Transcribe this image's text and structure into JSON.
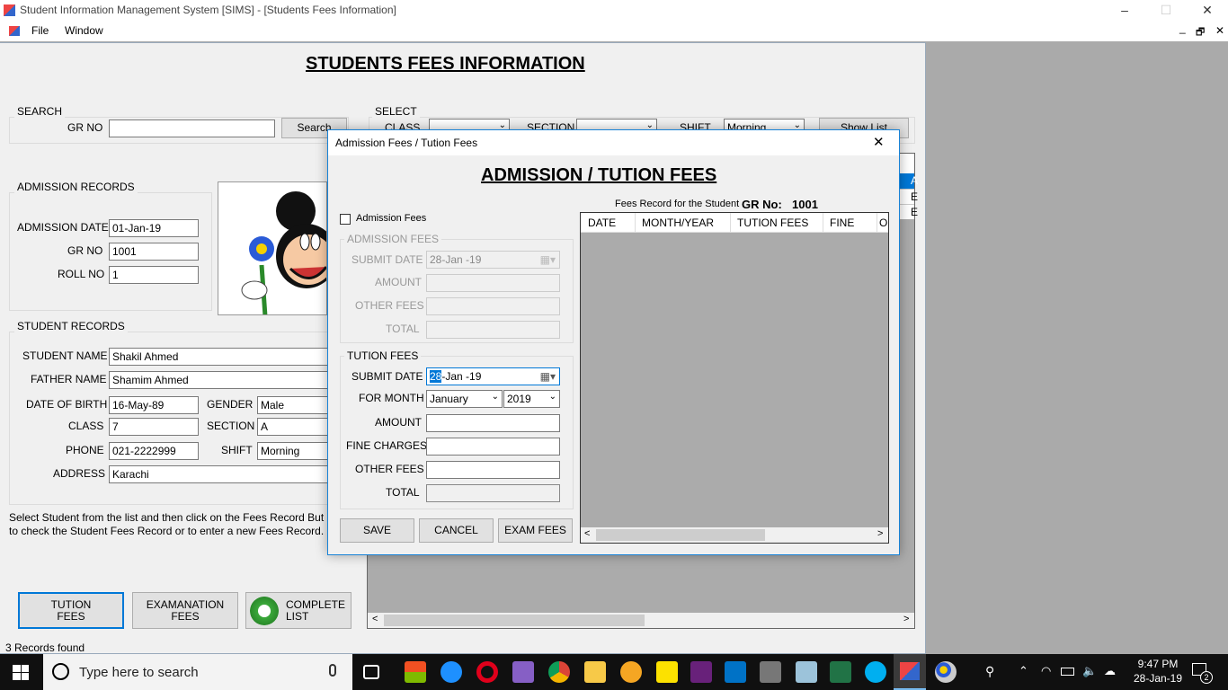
{
  "window": {
    "title": "Student Information Management System [SIMS] - [Students Fees Information]",
    "minimize": "–",
    "maximize": "☐",
    "close": "✕"
  },
  "menu": {
    "file": "File",
    "window": "Window",
    "child_min": "_",
    "child_restore": "🗗",
    "child_close": "✕"
  },
  "form": {
    "heading": "STUDENTS FEES INFORMATION",
    "search": {
      "group": "SEARCH",
      "gr_label": "GR NO",
      "gr_value": "",
      "button": "Search"
    },
    "select": {
      "group": "SELECT",
      "class_label": "CLASS",
      "section_label": "SECTION",
      "shift_label": "SHIFT",
      "shift_value": "Morning",
      "show_list": "Show List"
    },
    "admission": {
      "group": "ADMISSION RECORDS",
      "date_label": "ADMISSION DATE",
      "date_value": "01-Jan-19",
      "gr_label": "GR NO",
      "gr_value": "1001",
      "roll_label": "ROLL NO",
      "roll_value": "1"
    },
    "student": {
      "group": "STUDENT RECORDS",
      "name_label": "STUDENT NAME",
      "name_value": "Shakil Ahmed",
      "father_label": "FATHER NAME",
      "father_value": "Shamim Ahmed",
      "dob_label": "DATE OF BIRTH",
      "dob_value": "16-May-89",
      "gender_label": "GENDER",
      "gender_value": "Male",
      "class_label": "CLASS",
      "class_value": "7",
      "section_label": "SECTION",
      "section_value": "A",
      "phone_label": "PHONE",
      "phone_value": "021-2222999",
      "shift_label": "SHIFT",
      "shift_value": "Morning",
      "address_label": "ADDRESS",
      "address_value": "Karachi"
    },
    "instruction_1": "Select Student from the list and then click on the Fees Record But",
    "instruction_2": "to check the Student Fees Record or to enter a new Fees Record.",
    "buttons": {
      "tution_1": "TUTION",
      "tution_2": "FEES",
      "exam_1": "EXAMANATION",
      "exam_2": "FEES",
      "complete_1": "COMPLETE",
      "complete_2": "LIST"
    },
    "grid_cells": [
      "A",
      "E",
      "E"
    ],
    "status": "3 Records found"
  },
  "dialog": {
    "title": "Admission Fees / Tution Fees",
    "close": "✕",
    "heading": "ADMISSION / TUTION FEES",
    "fees_record_label": "Fees Record for the Student",
    "gr_no_label": "GR No:",
    "gr_no_value": "1001",
    "admission_checkbox": "Admission Fees",
    "admission_group": "ADMISSION FEES",
    "adm_submit_label": "SUBMIT DATE",
    "adm_submit_value": "28-Jan -19",
    "adm_amount_label": "AMOUNT",
    "adm_other_label": "OTHER FEES",
    "adm_total_label": "TOTAL",
    "tution_group": "TUTION FEES",
    "tut_submit_label": "SUBMIT DATE",
    "tut_submit_day": "28",
    "tut_submit_rest": "-Jan -19",
    "month_label": "FOR MONTH",
    "month_value": "January",
    "year_value": "2019",
    "tut_amount_label": "AMOUNT",
    "fine_label": "FINE CHARGES",
    "tut_other_label": "OTHER FEES",
    "tut_total_label": "TOTAL",
    "columns": [
      "DATE",
      "MONTH/YEAR",
      "TUTION FEES",
      "FINE",
      "O"
    ],
    "save": "SAVE",
    "cancel": "CANCEL",
    "exam_fees": "EXAM FEES"
  },
  "taskbar": {
    "search_placeholder": "Type here to search",
    "time": "9:47 PM",
    "date": "28-Jan-19",
    "notifications": "2"
  }
}
